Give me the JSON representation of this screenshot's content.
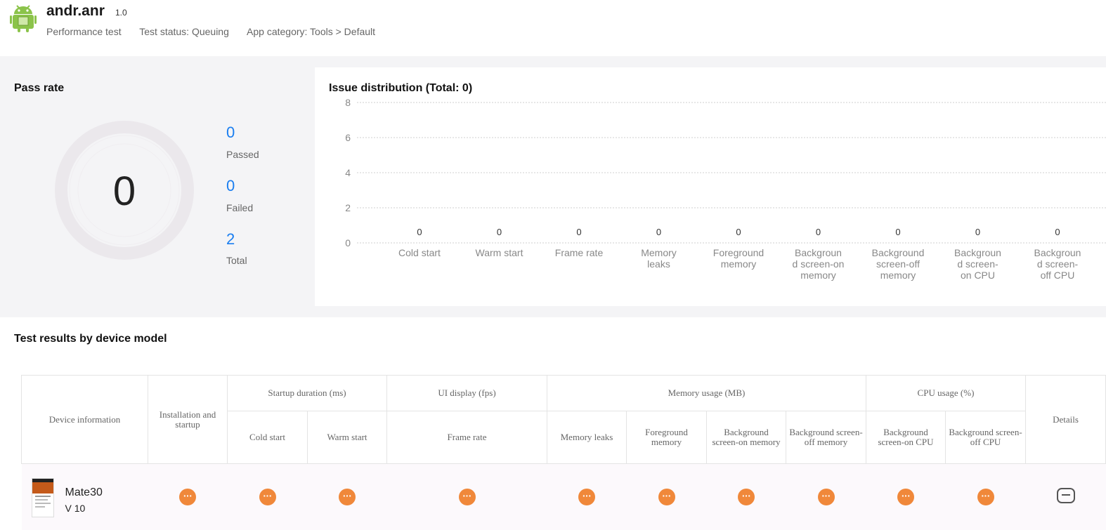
{
  "header": {
    "app_name": "andr.anr",
    "version": "1.0",
    "test_type": "Performance test",
    "test_status": "Test status: Queuing",
    "app_category": "App category: Tools > Default",
    "icon": "android-icon",
    "icon_color": "#8bc34a"
  },
  "pass_rate": {
    "title": "Pass rate",
    "center_value": "0",
    "passed_value": "0",
    "passed_label": "Passed",
    "failed_value": "0",
    "failed_label": "Failed",
    "total_value": "2",
    "total_label": "Total",
    "accent": "#1a7ef0"
  },
  "issue_chart": {
    "title": "Issue distribution (Total: 0)"
  },
  "chart_data": {
    "type": "bar",
    "title": "Issue distribution (Total: 0)",
    "categories": [
      "Cold start",
      "Warm start",
      "Frame rate",
      "Memory leaks",
      "Foreground memory",
      "Background screen-on memory",
      "Background screen-off memory",
      "Background screen-on CPU",
      "Background screen-off CPU"
    ],
    "category_lines": [
      [
        "Cold start"
      ],
      [
        "Warm start"
      ],
      [
        "Frame rate"
      ],
      [
        "Memory",
        "leaks"
      ],
      [
        "Foreground",
        "memory"
      ],
      [
        "Backgroun",
        "d screen-on",
        "memory"
      ],
      [
        "Background",
        "screen-off",
        "memory"
      ],
      [
        "Backgroun",
        "d screen-",
        "on CPU"
      ],
      [
        "Backgroun",
        "d screen-",
        "off CPU"
      ]
    ],
    "values": [
      0,
      0,
      0,
      0,
      0,
      0,
      0,
      0,
      0
    ],
    "data_labels": [
      "0",
      "0",
      "0",
      "0",
      "0",
      "0",
      "0",
      "0",
      "0"
    ],
    "ylim": [
      0,
      8
    ],
    "yticks": [
      "0",
      "2",
      "4",
      "6",
      "8"
    ],
    "grid": true,
    "xlabel": "",
    "ylabel": ""
  },
  "results": {
    "title": "Test results by device model",
    "headers": {
      "device_info": "Device information",
      "install": "Installation and startup",
      "startup": "Startup duration (ms)",
      "ui": "UI display (fps)",
      "memory": "Memory usage (MB)",
      "cpu": "CPU usage (%)",
      "details": "Details",
      "cold": "Cold start",
      "warm": "Warm start",
      "frame": "Frame rate",
      "mem_leaks": "Memory leaks",
      "fg_mem": "Foreground memory",
      "bg_on_mem": "Background screen-on memory",
      "bg_off_mem": "Background screen-off memory",
      "bg_on_cpu": "Background screen-on CPU",
      "bg_off_cpu": "Background screen-off CPU"
    },
    "rows": [
      {
        "device": "Mate30",
        "os": "V 10",
        "status_icon": "···",
        "status_color": "#f0883a",
        "details_icon": "details-icon"
      }
    ]
  }
}
